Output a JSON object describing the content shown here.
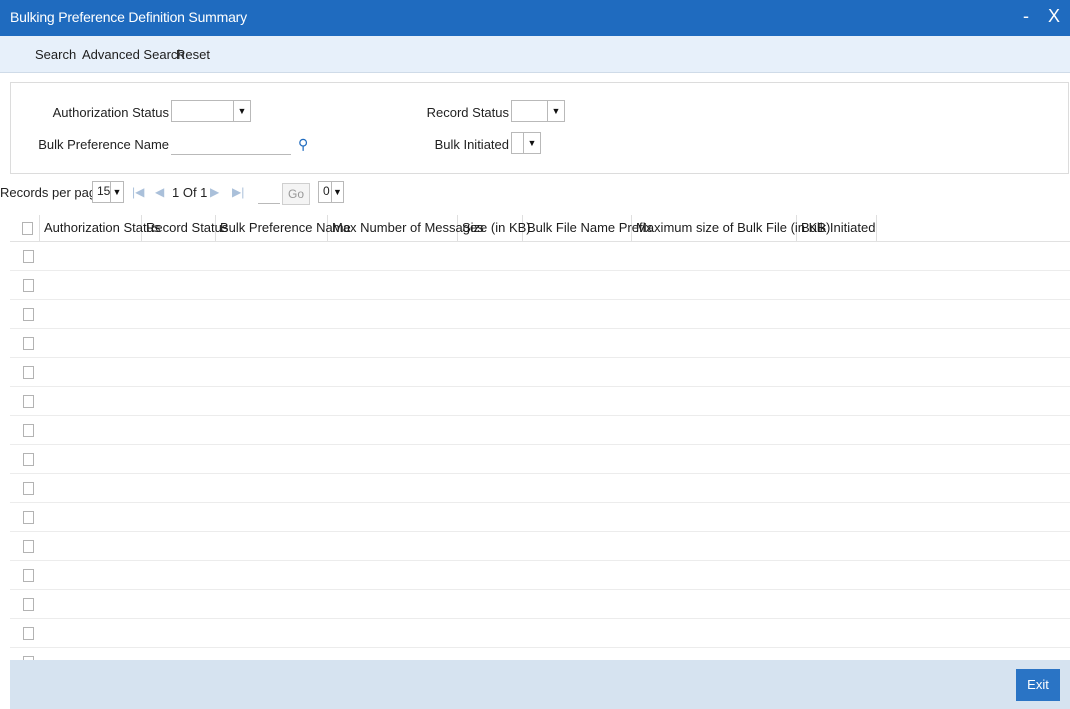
{
  "window": {
    "title": "Bulking Preference Definition Summary",
    "minimize": "-",
    "close": "X"
  },
  "toolbar": {
    "search": "Search",
    "advanced_search": "Advanced Search",
    "reset": "Reset"
  },
  "criteria": {
    "authorization_status_label": "Authorization Status",
    "authorization_status_value": "",
    "record_status_label": "Record Status",
    "record_status_value": "",
    "bulk_preference_name_label": "Bulk Preference Name",
    "bulk_preference_name_value": "",
    "bulk_initiated_label": "Bulk Initiated",
    "bulk_initiated_value": ""
  },
  "pager": {
    "records_per_page_label": "Records per page",
    "records_per_page_value": "15",
    "page_info": "1 Of 1",
    "go_label": "Go",
    "extra_select_value": "0"
  },
  "grid": {
    "columns": [
      "Authorization Status",
      "Record Status",
      "Bulk Preference Name",
      "Max Number of Messages",
      "Size (in KB)",
      "Bulk File Name Prefix",
      "Maximum size of Bulk File (in KB)",
      "Bulk Initiated"
    ],
    "row_count": 15
  },
  "footer": {
    "exit_label": "Exit"
  },
  "colors": {
    "titlebar": "#1f6bbf",
    "toolbar": "#e7f0fa",
    "footer": "#d6e3f0",
    "exit_button": "#2a74c5"
  }
}
